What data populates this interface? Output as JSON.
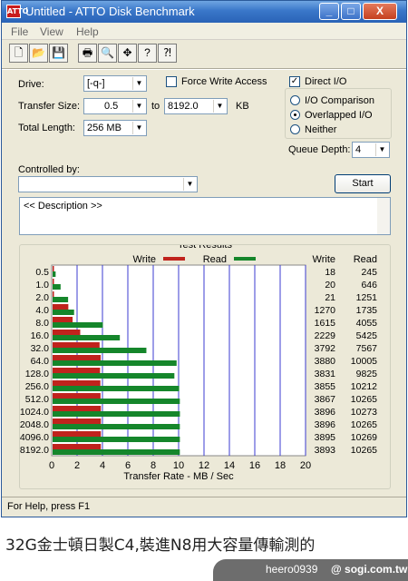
{
  "window": {
    "title": "Untitled - ATTO Disk Benchmark",
    "app_icon_text": "ATTO",
    "buttons": {
      "minimize": "_",
      "maximize": "□",
      "close": "X"
    }
  },
  "menu": [
    "File",
    "View",
    "Help"
  ],
  "toolbar": {
    "icons": [
      "new-file-icon",
      "open-folder-icon",
      "save-icon",
      "print-icon",
      "print-preview-icon",
      "move-icon",
      "help-icon",
      "context-help-icon"
    ],
    "glyphs": [
      "🗋",
      "📂",
      "💾",
      "🖶",
      "🔍",
      "✥",
      "?",
      "⁈"
    ]
  },
  "form": {
    "drive_label": "Drive:",
    "drive_value": "[-q-]",
    "force_write_label": "Force Write Access",
    "force_write_checked": false,
    "direct_io_label": "Direct I/O",
    "direct_io_checked": true,
    "transfer_size_label": "Transfer Size:",
    "transfer_from": "0.5",
    "to_label": "to",
    "transfer_to": "8192.0",
    "kb_label": "KB",
    "total_length_label": "Total Length:",
    "total_length_value": "256 MB",
    "io_options": [
      "I/O Comparison",
      "Overlapped I/O",
      "Neither"
    ],
    "io_selected": "Overlapped I/O",
    "queue_depth_label": "Queue Depth:",
    "queue_depth_value": "4",
    "controlled_by_label": "Controlled by:",
    "controlled_by_value": "",
    "start_label": "Start",
    "description_text": "<< Description >>"
  },
  "results": {
    "group_label": "Test Results",
    "write_col": "Write",
    "read_col": "Read"
  },
  "status_text": "For Help, press F1",
  "caption": "32G金士頓日製C4,裝進N8用大容量傳輸測的",
  "footer": {
    "user": "heero0939",
    "site": "@ sogi.com.tw"
  },
  "colors": {
    "write": "#c0231d",
    "read": "#15862b",
    "grid": "#3b3bd1"
  },
  "chart_data": {
    "type": "bar",
    "orientation": "horizontal",
    "categories": [
      "0.5",
      "1.0",
      "2.0",
      "4.0",
      "8.0",
      "16.0",
      "32.0",
      "64.0",
      "128.0",
      "256.0",
      "512.0",
      "1024.0",
      "2048.0",
      "4096.0",
      "8192.0"
    ],
    "series": [
      {
        "name": "Write",
        "values": [
          18,
          20,
          21,
          1270,
          1615,
          2229,
          3792,
          3880,
          3831,
          3855,
          3867,
          3896,
          3896,
          3895,
          3893
        ]
      },
      {
        "name": "Read",
        "values": [
          245,
          646,
          1251,
          1735,
          4055,
          5425,
          7567,
          10005,
          9825,
          10212,
          10265,
          10273,
          10265,
          10269,
          10265
        ]
      }
    ],
    "x_ticks": [
      "0",
      "2",
      "4",
      "6",
      "8",
      "10",
      "12",
      "14",
      "16",
      "18",
      "20"
    ],
    "xlim": [
      0,
      20
    ],
    "xlabel": "Transfer Rate - MB / Sec",
    "legend_position": "top",
    "grid": true
  }
}
